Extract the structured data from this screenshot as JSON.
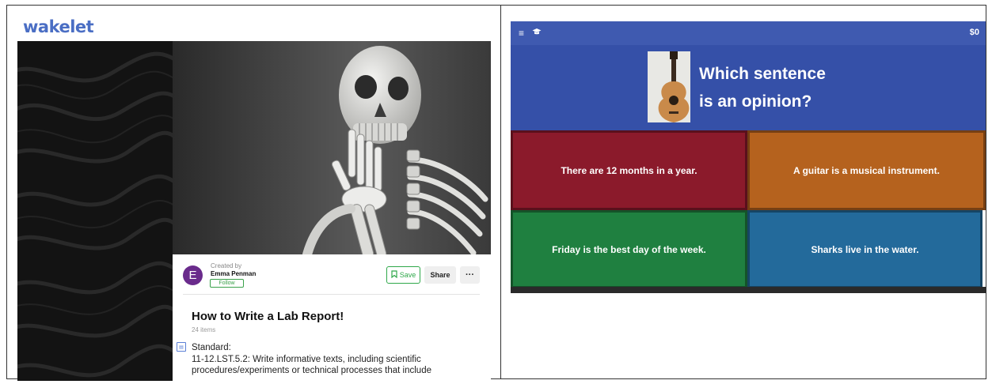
{
  "wakelet": {
    "logo": "wakelet",
    "created_by_label": "Created by",
    "author": "Emma Penman",
    "avatar_initial": "E",
    "follow_label": "Follow",
    "save_label": "Save",
    "share_label": "Share",
    "more_label": "···",
    "collection_title": "How to Write a Lab Report!",
    "item_count": "24 items",
    "standard_heading": "Standard:",
    "standard_text": "11-12.LST.5.2: Write informative texts, including scientific procedures/experiments or technical processes that include"
  },
  "quiz": {
    "menu_icon": "hamburger-icon",
    "cap_icon": "graduation-cap-icon",
    "money": "$0",
    "question_line1": "Which sentence",
    "question_line2": "is an opinion?",
    "options": [
      {
        "text": "There are 12 months in a year.",
        "color": "#8b1a2b"
      },
      {
        "text": "A guitar is a musical instrument.",
        "color": "#b5621e"
      },
      {
        "text": "Friday is the best day of the week.",
        "color": "#1f8040"
      },
      {
        "text": "Sharks live in the water.",
        "color": "#236a9b"
      }
    ]
  }
}
